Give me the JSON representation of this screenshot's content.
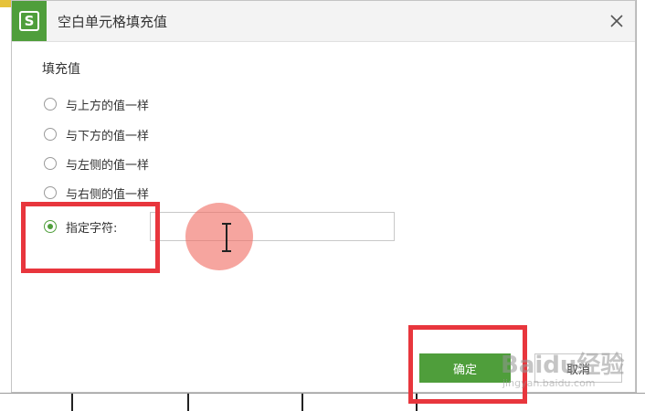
{
  "dialog": {
    "title": "空白单元格填充值",
    "section_label": "填充值",
    "options": [
      {
        "label": "与上方的值一样",
        "checked": false
      },
      {
        "label": "与下方的值一样",
        "checked": false
      },
      {
        "label": "与左侧的值一样",
        "checked": false
      },
      {
        "label": "与右侧的值一样",
        "checked": false
      },
      {
        "label": "指定字符:",
        "checked": true
      }
    ],
    "char_input_value": "",
    "ok_label": "确定",
    "cancel_label": "取消"
  },
  "app_logo_letter": "S",
  "watermark": {
    "main": "Baidu经验",
    "sub": "jingyan.baidu.com"
  },
  "colors": {
    "accent": "#4f9e3b",
    "highlight": "#e8363d"
  },
  "icons": {
    "close": "close-icon",
    "cursor": "text-cursor-icon",
    "logo": "wps-logo-icon"
  }
}
